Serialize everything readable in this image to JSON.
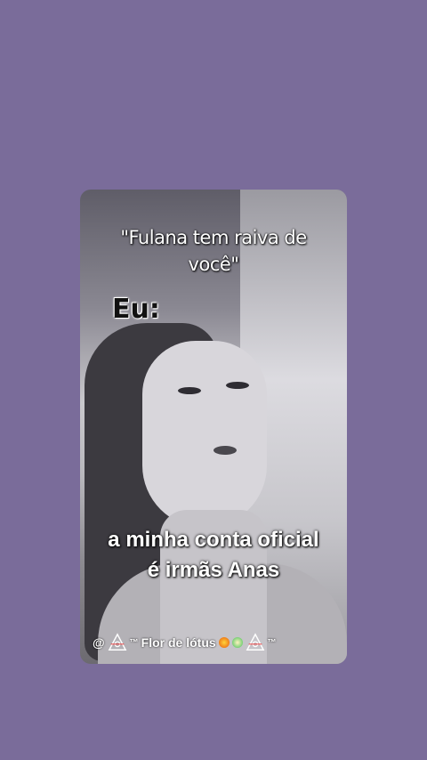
{
  "post": {
    "caption_top": "\"Fulana tem raiva de você\"",
    "label": "Eu:",
    "caption_bottom_line1": "a minha conta oficial",
    "caption_bottom_line2": "é irmãs Anas",
    "watermark": {
      "at": "@",
      "tm1": "™",
      "name": "Flor de lótus",
      "tm2": "™"
    }
  },
  "colors": {
    "background": "#7a6c9a"
  }
}
